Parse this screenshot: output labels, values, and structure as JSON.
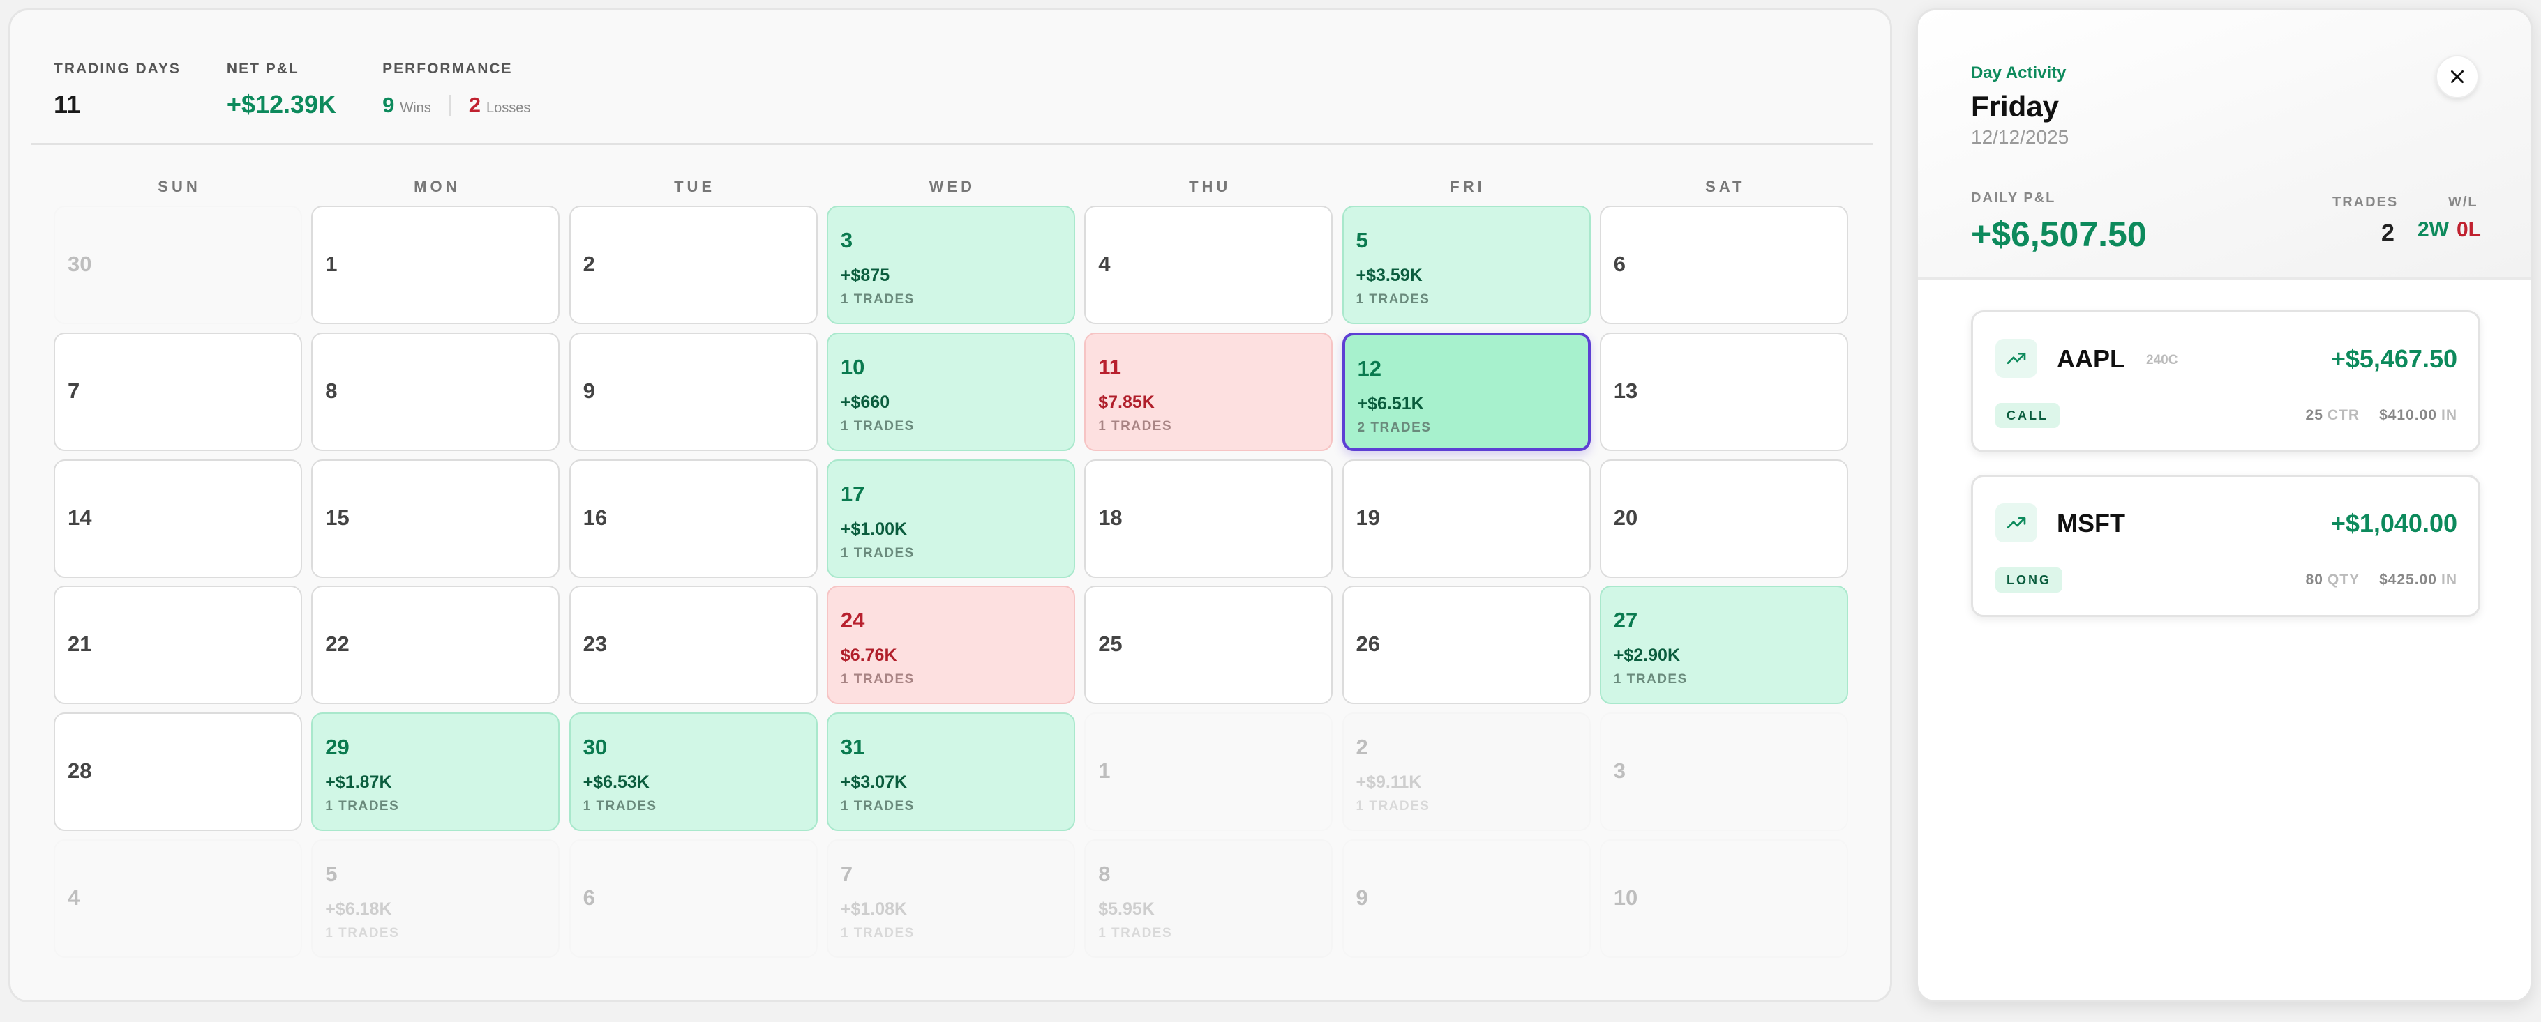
{
  "stats": {
    "trading_days_label": "TRADING DAYS",
    "trading_days_value": "11",
    "net_pnl_label": "NET P&L",
    "net_pnl_value": "+$12.39K",
    "performance_label": "PERFORMANCE",
    "wins_count": "9",
    "wins_label": "Wins",
    "losses_count": "2",
    "losses_label": "Losses"
  },
  "weekdays": [
    "SUN",
    "MON",
    "TUE",
    "WED",
    "THU",
    "FRI",
    "SAT"
  ],
  "days": [
    {
      "d": "30",
      "s": "faded"
    },
    {
      "d": "1",
      "s": "plain"
    },
    {
      "d": "2",
      "s": "plain"
    },
    {
      "d": "3",
      "s": "win",
      "pnl": "+$875",
      "trades": "1 TRADES"
    },
    {
      "d": "4",
      "s": "plain"
    },
    {
      "d": "5",
      "s": "win",
      "pnl": "+$3.59K",
      "trades": "1 TRADES"
    },
    {
      "d": "6",
      "s": "plain"
    },
    {
      "d": "7",
      "s": "plain"
    },
    {
      "d": "8",
      "s": "plain"
    },
    {
      "d": "9",
      "s": "plain"
    },
    {
      "d": "10",
      "s": "win",
      "pnl": "+$660",
      "trades": "1 TRADES"
    },
    {
      "d": "11",
      "s": "loss",
      "pnl": "$7.85K",
      "trades": "1 TRADES"
    },
    {
      "d": "12",
      "s": "selected",
      "pnl": "+$6.51K",
      "trades": "2 TRADES"
    },
    {
      "d": "13",
      "s": "plain"
    },
    {
      "d": "14",
      "s": "plain"
    },
    {
      "d": "15",
      "s": "plain"
    },
    {
      "d": "16",
      "s": "plain"
    },
    {
      "d": "17",
      "s": "win",
      "pnl": "+$1.00K",
      "trades": "1 TRADES"
    },
    {
      "d": "18",
      "s": "plain"
    },
    {
      "d": "19",
      "s": "plain"
    },
    {
      "d": "20",
      "s": "plain"
    },
    {
      "d": "21",
      "s": "plain"
    },
    {
      "d": "22",
      "s": "plain"
    },
    {
      "d": "23",
      "s": "plain"
    },
    {
      "d": "24",
      "s": "loss",
      "pnl": "$6.76K",
      "trades": "1 TRADES"
    },
    {
      "d": "25",
      "s": "plain"
    },
    {
      "d": "26",
      "s": "plain"
    },
    {
      "d": "27",
      "s": "win",
      "pnl": "+$2.90K",
      "trades": "1 TRADES"
    },
    {
      "d": "28",
      "s": "plain"
    },
    {
      "d": "29",
      "s": "win",
      "pnl": "+$1.87K",
      "trades": "1 TRADES"
    },
    {
      "d": "30",
      "s": "win",
      "pnl": "+$6.53K",
      "trades": "1 TRADES"
    },
    {
      "d": "31",
      "s": "win",
      "pnl": "+$3.07K",
      "trades": "1 TRADES"
    },
    {
      "d": "1",
      "s": "faded"
    },
    {
      "d": "2",
      "s": "faded",
      "pnl": "+$9.11K",
      "trades": "1 TRADES"
    },
    {
      "d": "3",
      "s": "faded"
    },
    {
      "d": "4",
      "s": "faded"
    },
    {
      "d": "5",
      "s": "faded",
      "pnl": "+$6.18K",
      "trades": "1 TRADES"
    },
    {
      "d": "6",
      "s": "faded"
    },
    {
      "d": "7",
      "s": "faded",
      "pnl": "+$1.08K",
      "trades": "1 TRADES"
    },
    {
      "d": "8",
      "s": "faded",
      "pnl": "$5.95K",
      "trades": "1 TRADES"
    },
    {
      "d": "9",
      "s": "faded"
    },
    {
      "d": "10",
      "s": "faded"
    }
  ],
  "panel": {
    "subtitle": "Day Activity",
    "day_name": "Friday",
    "date": "12/12/2025",
    "daily_pnl_label": "DAILY P&L",
    "daily_pnl_value": "+$6,507.50",
    "trades_label": "TRADES",
    "trades_value": "2",
    "wl_label": "W/L",
    "wins": "2W",
    "losses": "0L"
  },
  "trades": [
    {
      "ticker": "AAPL",
      "contract": "240C",
      "pnl": "+$5,467.50",
      "type": "CALL",
      "qty": "25",
      "qty_unit": "CTR",
      "price": "$410.00",
      "price_unit": "IN"
    },
    {
      "ticker": "MSFT",
      "contract": "",
      "pnl": "+$1,040.00",
      "type": "LONG",
      "qty": "80",
      "qty_unit": "QTY",
      "price": "$425.00",
      "price_unit": "IN"
    }
  ],
  "colors": {
    "win": "#0d8a5c",
    "loss": "#c0212f",
    "selected_border": "#5d3fd3",
    "win_cell": "#d1f7e6",
    "loss_cell": "#fde0e0"
  },
  "icons": {
    "close": "close-icon",
    "trend": "trending-up-icon"
  }
}
